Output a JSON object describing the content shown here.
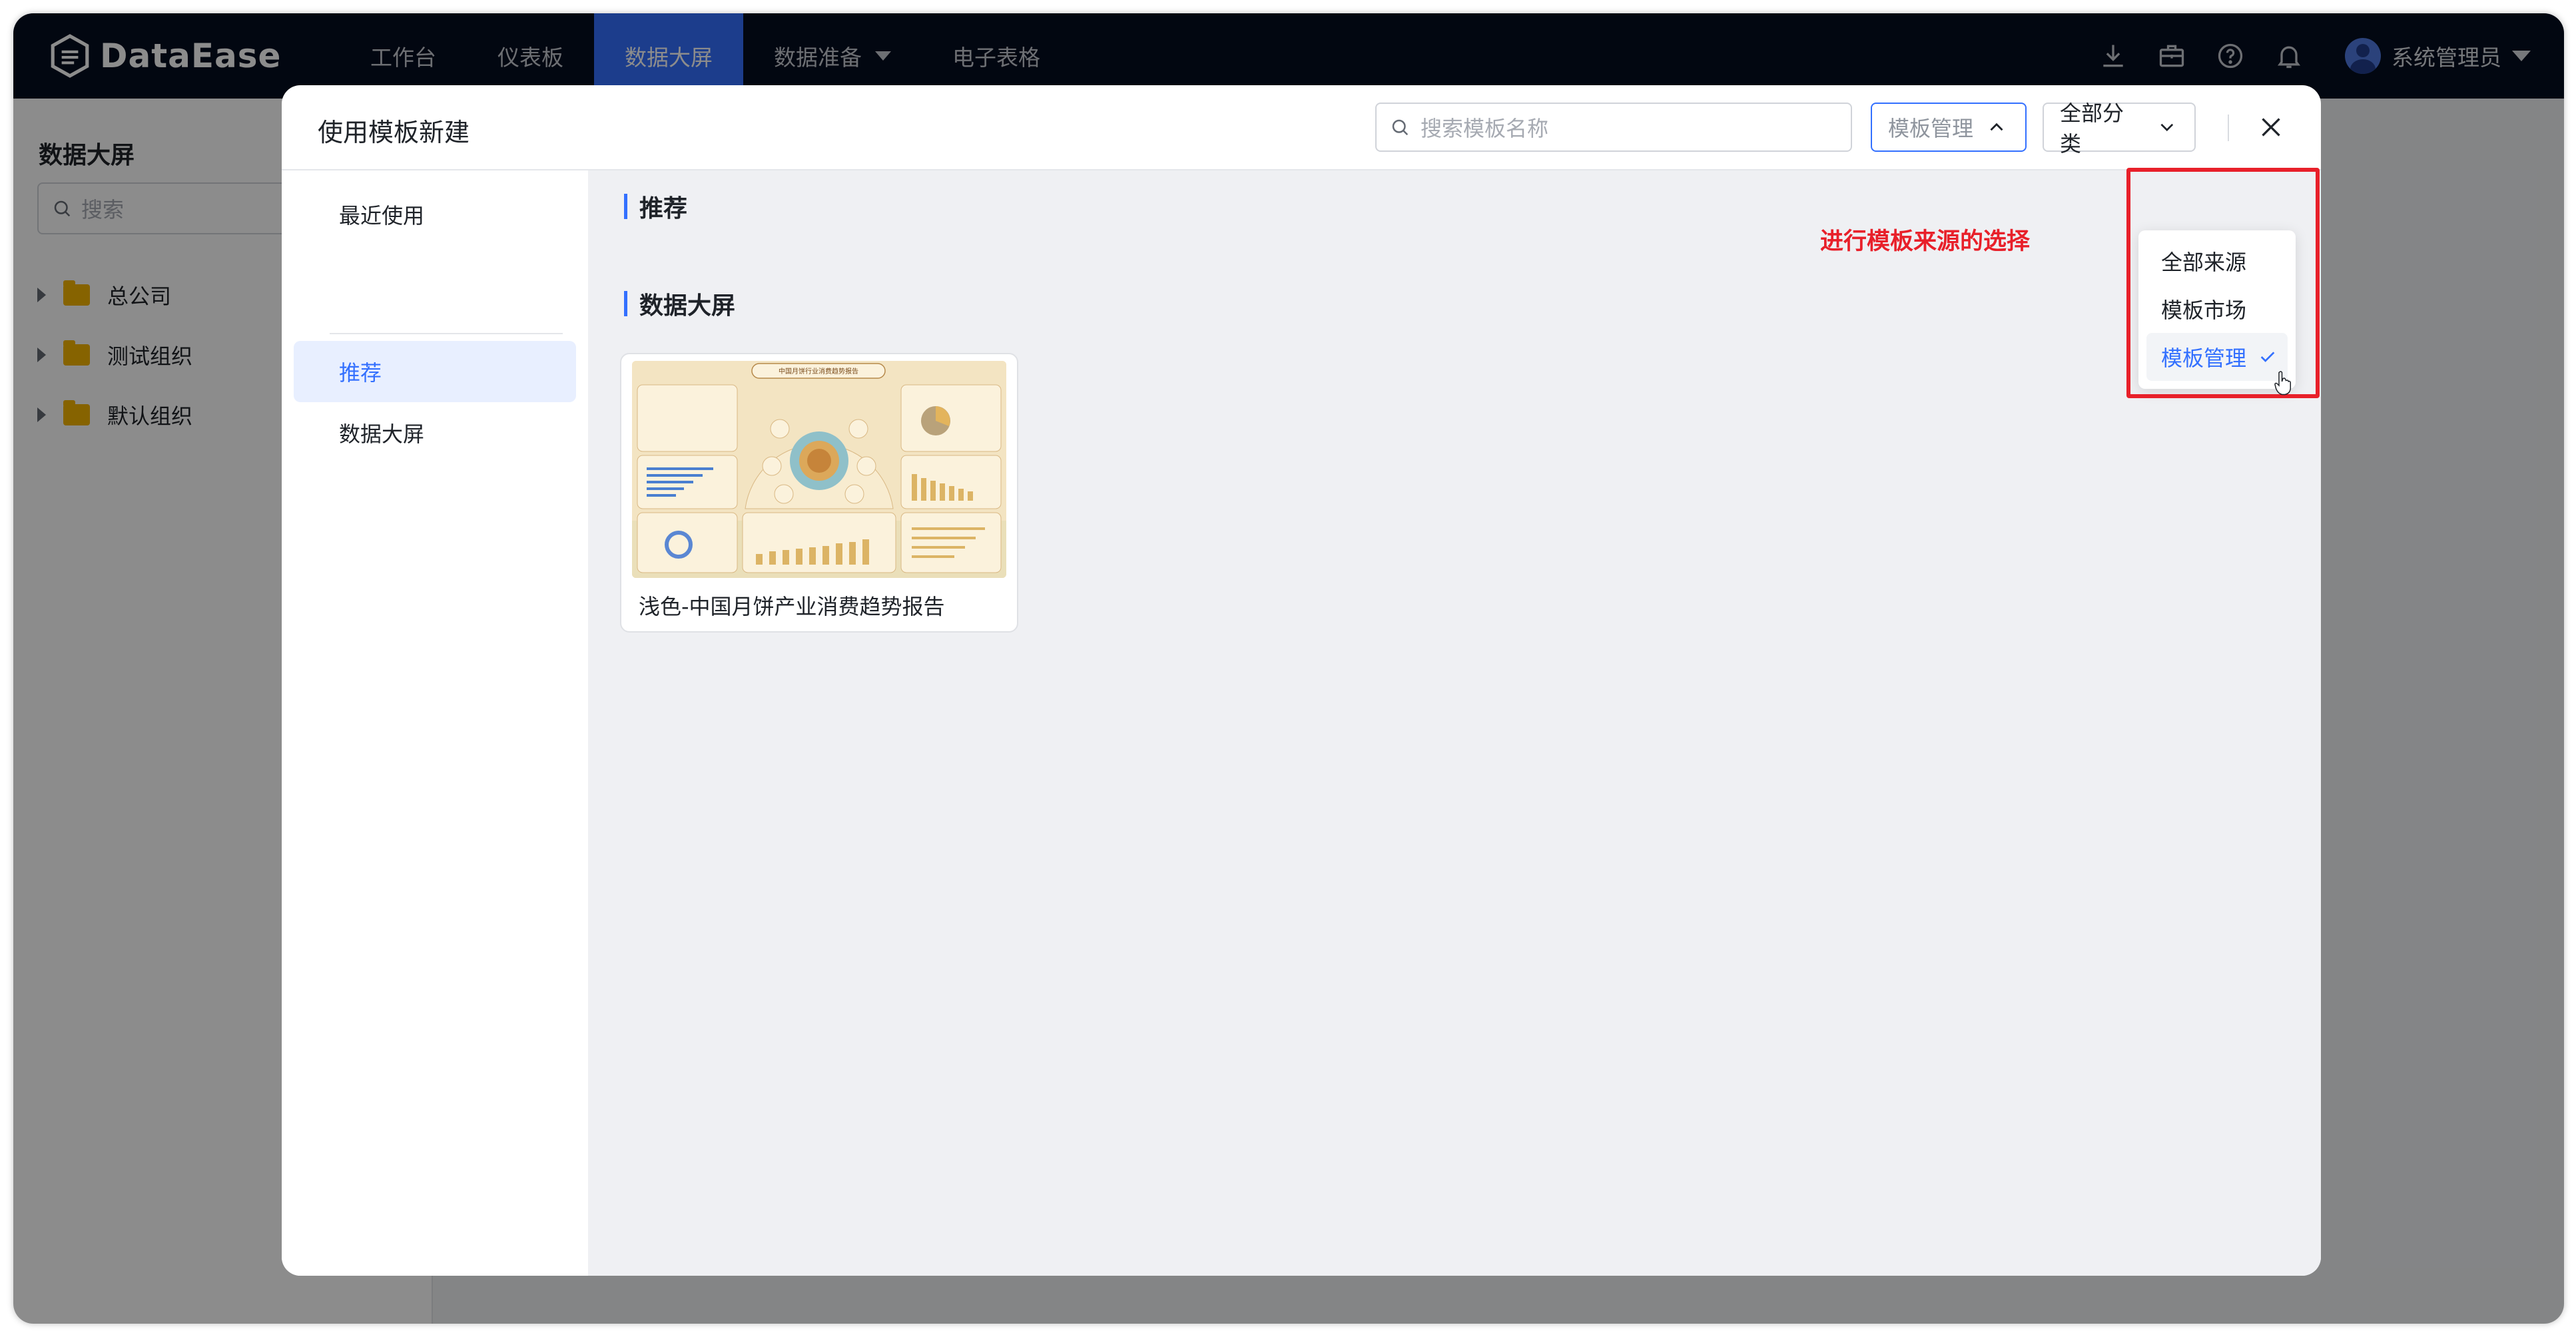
{
  "app": {
    "logo_text": "DataEase",
    "nav": [
      {
        "label": "工作台"
      },
      {
        "label": "仪表板"
      },
      {
        "label": "数据大屏"
      },
      {
        "label": "数据准备"
      },
      {
        "label": "电子表格"
      }
    ],
    "user_name": "系统管理员",
    "colors": {
      "topbar": "#050d1f",
      "accent": "#3370ff",
      "annotation": "#e8202a"
    }
  },
  "left_panel": {
    "title": "数据大屏",
    "search_placeholder": "搜索",
    "tree": [
      {
        "label": "总公司"
      },
      {
        "label": "测试组织"
      },
      {
        "label": "默认组织"
      }
    ]
  },
  "dialog": {
    "title": "使用模板新建",
    "search_placeholder": "搜索模板名称",
    "source_select_value": "模板管理",
    "category_select_value": "全部分类",
    "side_menu": [
      {
        "label": "最近使用"
      },
      {
        "label": "推荐"
      },
      {
        "label": "数据大屏"
      }
    ],
    "sections": [
      {
        "title": "推荐"
      },
      {
        "title": "数据大屏"
      }
    ],
    "annotation": "进行模板来源的选择",
    "template_card": {
      "name": "浅色-中国月饼产业消费趋势报告",
      "thumb_title": "中国月饼行业消费趋势报告"
    },
    "source_dropdown": {
      "options": [
        {
          "label": "全部来源"
        },
        {
          "label": "模板市场"
        },
        {
          "label": "模板管理"
        }
      ],
      "selected": "模板管理"
    }
  }
}
